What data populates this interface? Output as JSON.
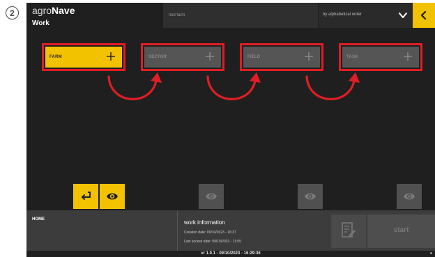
{
  "step_badge": "2",
  "header": {
    "brand_light": "agro",
    "brand_bold": "Nave",
    "screen_title": "Work",
    "search_placeholder": "find farm",
    "sort_label": "by alphabetical order"
  },
  "steps": [
    {
      "label": "FARM",
      "active": true
    },
    {
      "label": "SECTOR",
      "active": false
    },
    {
      "label": "FIELD",
      "active": false
    },
    {
      "label": "TASK",
      "active": false
    }
  ],
  "footer": {
    "home_label": "HOME",
    "info_title": "work information",
    "creation_date": "Creation date: 09/10/2023 - 16:37",
    "last_access": "Last access date: 09/10/2023 - 11:05",
    "start_label": "start"
  },
  "version": "vr 1.0.1 - 09/10/2023 - 16:29:36",
  "colors": {
    "accent_yellow": "#f2c200",
    "highlight_red": "#e01d24",
    "background": "#1f1f1f"
  },
  "icons": [
    "search-icon",
    "chevron-down-icon",
    "back-icon",
    "plus-icon",
    "eye-icon",
    "return-icon",
    "report-icon"
  ]
}
